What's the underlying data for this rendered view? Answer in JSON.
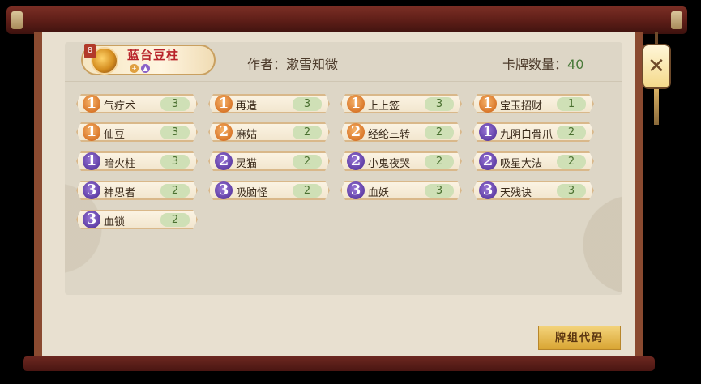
{
  "deck": {
    "name": "蓝台豆柱",
    "tag": "8",
    "icon_a": "+",
    "icon_b": "▲"
  },
  "author": {
    "label": "作者：",
    "name": "漱雪知微"
  },
  "card_count": {
    "label": "卡牌数量：",
    "value": "40"
  },
  "cards": [
    {
      "cost": "1",
      "name": "气疗术",
      "qty": "3",
      "color": "orange"
    },
    {
      "cost": "1",
      "name": "再造",
      "qty": "3",
      "color": "orange"
    },
    {
      "cost": "1",
      "name": "上上签",
      "qty": "3",
      "color": "orange"
    },
    {
      "cost": "1",
      "name": "宝玉招财",
      "qty": "1",
      "color": "orange"
    },
    {
      "cost": "1",
      "name": "仙豆",
      "qty": "3",
      "color": "orange"
    },
    {
      "cost": "2",
      "name": "麻姑",
      "qty": "2",
      "color": "orange"
    },
    {
      "cost": "2",
      "name": "经纶三转",
      "qty": "2",
      "color": "orange"
    },
    {
      "cost": "1",
      "name": "九阴白骨爪",
      "qty": "2",
      "color": "purple"
    },
    {
      "cost": "1",
      "name": "暗火柱",
      "qty": "3",
      "color": "purple"
    },
    {
      "cost": "2",
      "name": "灵猫",
      "qty": "2",
      "color": "purple"
    },
    {
      "cost": "2",
      "name": "小鬼夜哭",
      "qty": "2",
      "color": "purple"
    },
    {
      "cost": "2",
      "name": "吸星大法",
      "qty": "2",
      "color": "purple"
    },
    {
      "cost": "3",
      "name": "神思者",
      "qty": "2",
      "color": "purple"
    },
    {
      "cost": "3",
      "name": "吸脑怪",
      "qty": "2",
      "color": "purple"
    },
    {
      "cost": "3",
      "name": "血妖",
      "qty": "3",
      "color": "purple"
    },
    {
      "cost": "3",
      "name": "天残诀",
      "qty": "3",
      "color": "purple"
    },
    {
      "cost": "3",
      "name": "血锁",
      "qty": "2",
      "color": "purple"
    }
  ],
  "buttons": {
    "deck_code": "牌组代码"
  },
  "icons": {
    "close": "close-icon",
    "deck_avatar": "deck-avatar-icon"
  }
}
